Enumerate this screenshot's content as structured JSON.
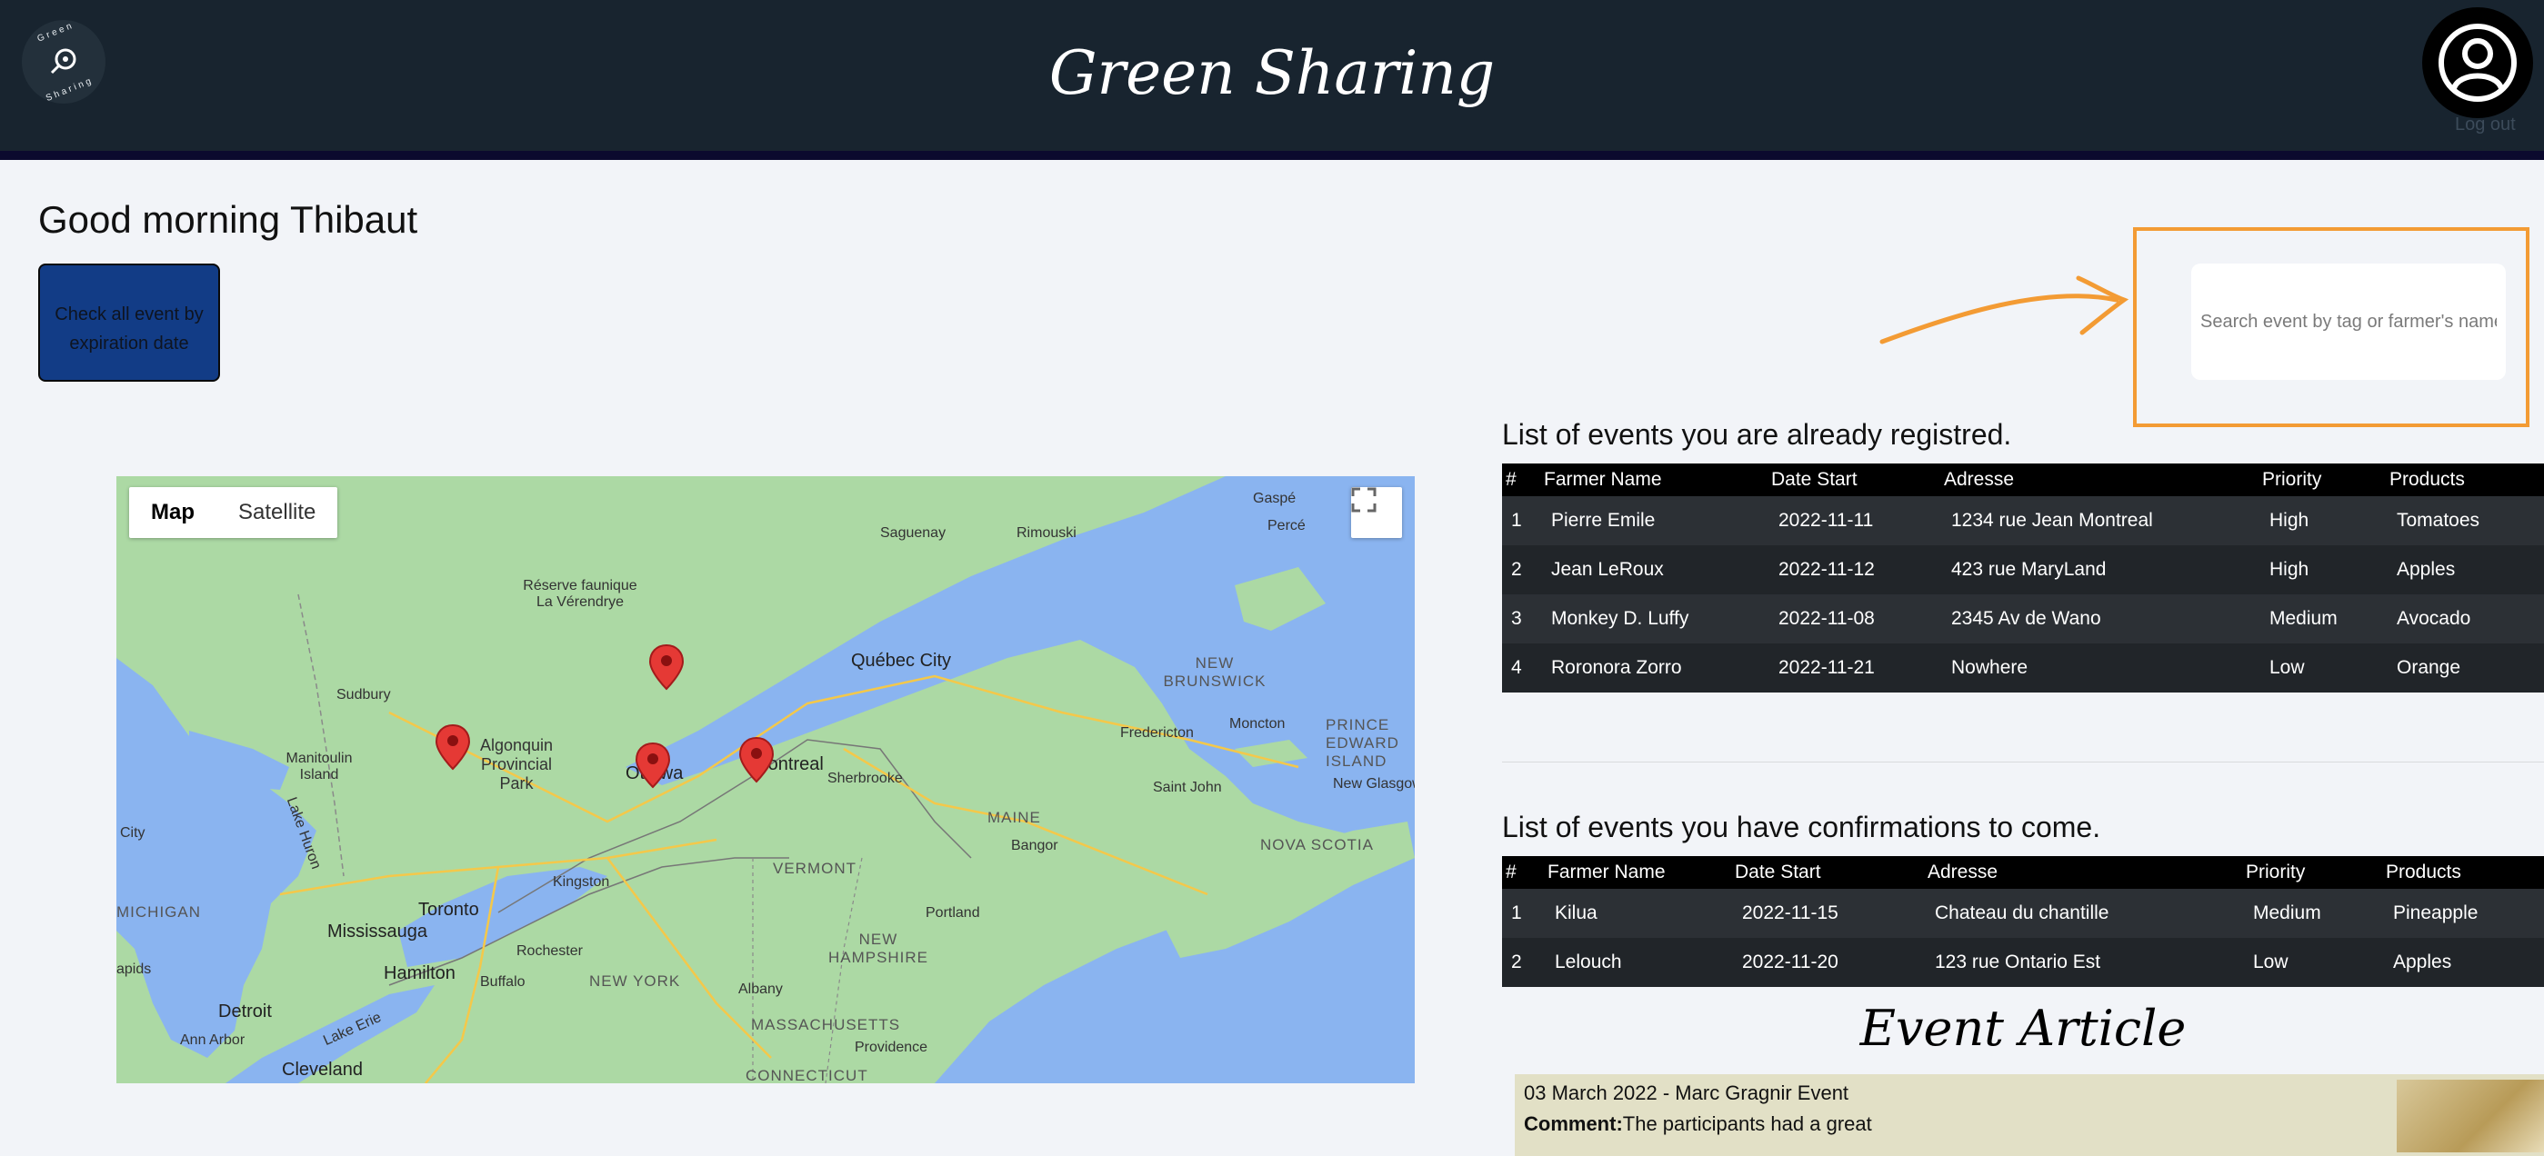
{
  "header": {
    "logo_top": "Green",
    "logo_bottom": "Sharing",
    "title": "Green Sharing",
    "logout": "Log out"
  },
  "greeting": "Good morning Thibaut",
  "expire_button": "Check all event by expiration date",
  "search": {
    "placeholder": "Search event by tag or farmer's name"
  },
  "map": {
    "toggle": [
      "Map",
      "Satellite"
    ],
    "labels": {
      "gaspe": "Gaspé",
      "perce": "Percé",
      "saguenay": "Saguenay",
      "rimouski": "Rimouski",
      "reserve": "Réserve faunique La Vérendrye",
      "quebec": "Québec City",
      "newbrunswick": "NEW BRUNSWICK",
      "sudbury": "Sudbury",
      "fredericton": "Fredericton",
      "moncton": "Moncton",
      "pei": "PRINCE EDWARD ISLAND",
      "manitoulin": "Manitoulin Island",
      "algonquin": "Algonquin Provincial Park",
      "ottawa": "Ottawa",
      "montreal": "Montreal",
      "sherbrooke": "Sherbrooke",
      "saintjohn": "Saint John",
      "newglasgow": "New Glasgow",
      "maine": "MAINE",
      "bangor": "Bangor",
      "novascotia": "NOVA SCOTIA",
      "city": "City",
      "lakehuron": "Lake Huron",
      "kingston": "Kingston",
      "vermont": "VERMONT",
      "michigan": "MICHIGAN",
      "toronto": "Toronto",
      "mississauga": "Mississauga",
      "rochester": "Rochester",
      "portland": "Portland",
      "newhampshire": "NEW HAMPSHIRE",
      "hamilton": "Hamilton",
      "buffalo": "Buffalo",
      "newyork": "NEW YORK",
      "albany": "Albany",
      "apids": "apids",
      "detroit": "Detroit",
      "annarbor": "Ann Arbor",
      "massachusetts": "MASSACHUSETTS",
      "lakeerie": "Lake Erie",
      "providence": "Providence",
      "cleveland": "Cleveland",
      "connecticut": "CONNECTICUT"
    }
  },
  "registered": {
    "title": "List of events you are already registred.",
    "headers": [
      "#",
      "Farmer Name",
      "Date Start",
      "Adresse",
      "Priority",
      "Products"
    ],
    "rows": [
      [
        "1",
        "Pierre Emile",
        "2022-11-11",
        "1234 rue Jean Montreal",
        "High",
        "Tomatoes"
      ],
      [
        "2",
        "Jean LeRoux",
        "2022-11-12",
        "423 rue MaryLand",
        "High",
        "Apples"
      ],
      [
        "3",
        "Monkey D. Luffy",
        "2022-11-08",
        "2345 Av de Wano",
        "Medium",
        "Avocado"
      ],
      [
        "4",
        "Roronora Zorro",
        "2022-11-21",
        "Nowhere",
        "Low",
        "Orange"
      ]
    ]
  },
  "confirmations": {
    "title": "List of events you have confirmations to come.",
    "headers": [
      "#",
      "Farmer Name",
      "Date Start",
      "Adresse",
      "Priority",
      "Products"
    ],
    "rows": [
      [
        "1",
        "Kilua",
        "2022-11-15",
        "Chateau du chantille",
        "Medium",
        "Pineapple"
      ],
      [
        "2",
        "Lelouch",
        "2022-11-20",
        "123 rue Ontario Est",
        "Low",
        "Apples"
      ]
    ]
  },
  "article": {
    "section_title": "Event Article",
    "heading": "03 March 2022 - Marc Gragnir Event",
    "comment_label": "Comment:",
    "comment_text": "The participants had a great"
  },
  "colors": {
    "header_bg": "#18242f",
    "accent_orange": "#f39b34",
    "button_blue": "#123c86",
    "marker_red": "#e53935"
  }
}
